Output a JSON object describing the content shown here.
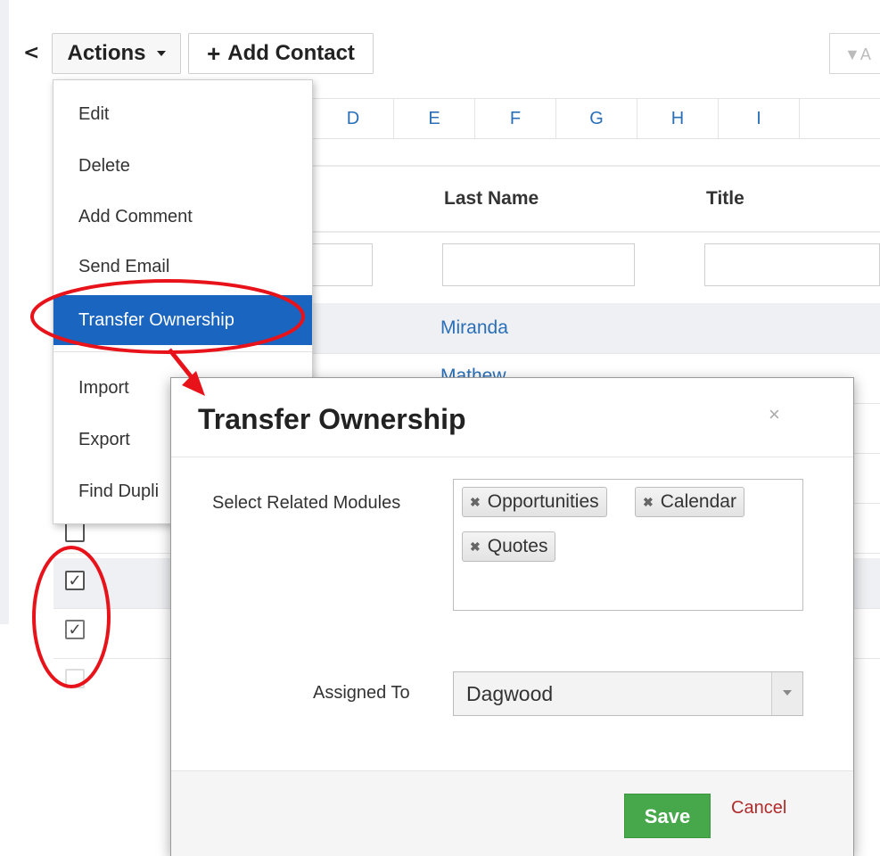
{
  "toolbar": {
    "collapse_glyph": "<",
    "actions_label": "Actions",
    "add_contact_label": "Add Contact",
    "filter_label": "A"
  },
  "alphabet": [
    "D",
    "E",
    "F",
    "G",
    "H",
    "I"
  ],
  "table": {
    "headers": {
      "last_name": "Last Name",
      "title": "Title"
    },
    "rows": [
      {
        "last_name": "Miranda"
      },
      {
        "last_name": "Mathew"
      }
    ]
  },
  "actions_menu": {
    "items": [
      {
        "label": "Edit"
      },
      {
        "label": "Delete"
      },
      {
        "label": "Add Comment"
      },
      {
        "label": "Send Email"
      },
      {
        "label": "Transfer Ownership",
        "active": true
      },
      {
        "label": "Import"
      },
      {
        "label": "Export"
      },
      {
        "label": "Find Dupli"
      }
    ]
  },
  "checkboxes": [
    {
      "checked": false
    },
    {
      "checked": true
    },
    {
      "checked": true
    }
  ],
  "modal": {
    "title": "Transfer Ownership",
    "close_glyph": "×",
    "related_modules_label": "Select Related Modules",
    "related_modules": [
      "Opportunities",
      "Calendar",
      "Quotes"
    ],
    "assigned_to_label": "Assigned To",
    "assigned_to_value": "Dagwood",
    "save_label": "Save",
    "cancel_label": "Cancel"
  },
  "colors": {
    "accent_blue": "#1a65c0",
    "link_blue": "#2a6fb7",
    "save_green": "#46a84a",
    "cancel_red": "#b02b2b",
    "annotation_red": "#e8131a"
  }
}
